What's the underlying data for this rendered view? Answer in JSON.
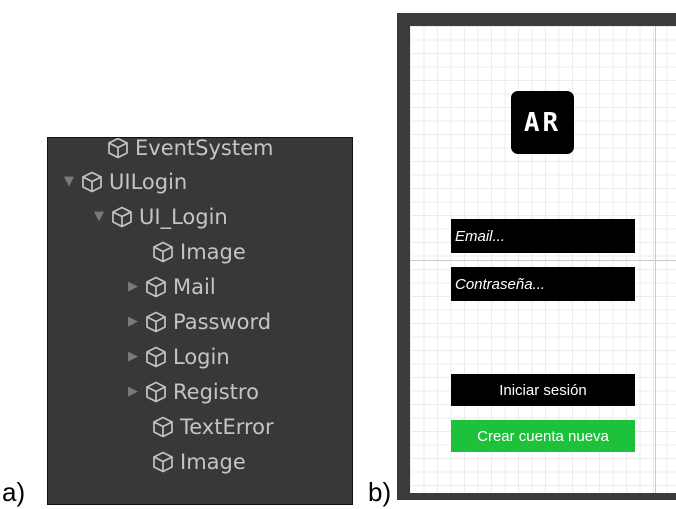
{
  "labels": {
    "a": "a)",
    "b": "b)"
  },
  "hierarchy": {
    "items": [
      {
        "name": "EventSystem",
        "expand": "none"
      },
      {
        "name": "UILogin",
        "expand": "expanded"
      },
      {
        "name": "UI_Login",
        "expand": "expanded"
      },
      {
        "name": "Image",
        "expand": "none"
      },
      {
        "name": "Mail",
        "expand": "collapsed"
      },
      {
        "name": "Password",
        "expand": "collapsed"
      },
      {
        "name": "Login",
        "expand": "collapsed"
      },
      {
        "name": "Registro",
        "expand": "collapsed"
      },
      {
        "name": "TextError",
        "expand": "none"
      },
      {
        "name": "Image",
        "expand": "none"
      }
    ]
  },
  "login": {
    "logo_text": "AR",
    "email_placeholder": "Email...",
    "password_placeholder": "Contraseña...",
    "login_button": "Iniciar sesión",
    "create_button": "Crear cuenta nueva"
  },
  "colors": {
    "hierarchy_bg": "#383838",
    "hierarchy_text": "#c4c4c4",
    "create_button": "#1ec23a",
    "scene_frame": "#3b3b3b"
  }
}
